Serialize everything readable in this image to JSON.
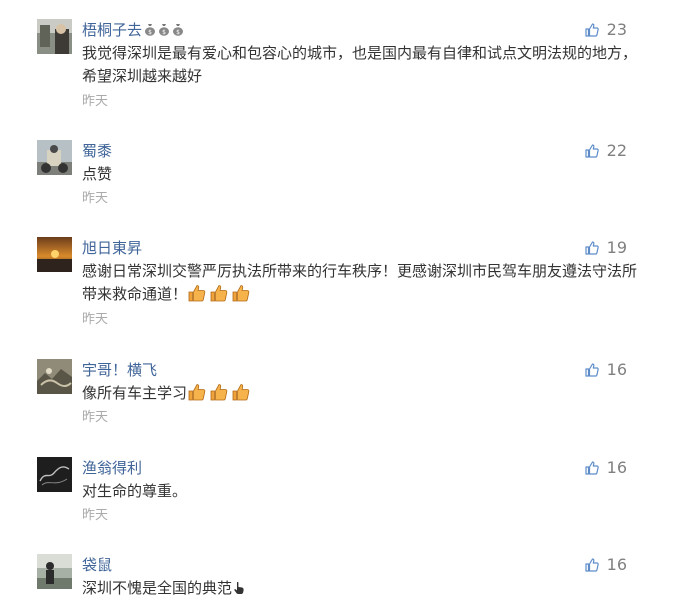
{
  "comments": [
    {
      "name": "梧桐子去",
      "likes": "23",
      "text": "我觉得深圳是最有爱心和包容心的城市，也是国内最有自律和试点文明法规的地方，希望深圳越来越好",
      "time": "昨天",
      "badge_icon": "money-bag-icon",
      "badge_count": 3
    },
    {
      "name": "蜀黍",
      "likes": "22",
      "text": "点赞",
      "time": "昨天"
    },
    {
      "name": "旭日東昇",
      "likes": "19",
      "text": "感谢日常深圳交警严厉执法所带来的行车秩序！更感谢深圳市民驾车朋友遵法守法所带来救命通道！",
      "time": "昨天",
      "emoji_icon": "thumbs-up-emoji",
      "emoji_count": 3
    },
    {
      "name": "宇哥！横飞",
      "likes": "16",
      "text": "像所有车主学习",
      "time": "昨天",
      "emoji_icon": "thumbs-up-emoji",
      "emoji_count": 3
    },
    {
      "name": "渔翁得利",
      "likes": "16",
      "text": "对生命的尊重。",
      "time": "昨天"
    },
    {
      "name": "袋鼠",
      "likes": "16",
      "text": "深圳不愧是全国的典范",
      "emoji_icon": "hand-pointing-emoji",
      "emoji_count": 1
    }
  ],
  "colors": {
    "name": "#406599",
    "text": "#333333",
    "time": "#aaaaaa",
    "like_icon": "#5d8cc9",
    "like_count": "#808080"
  }
}
